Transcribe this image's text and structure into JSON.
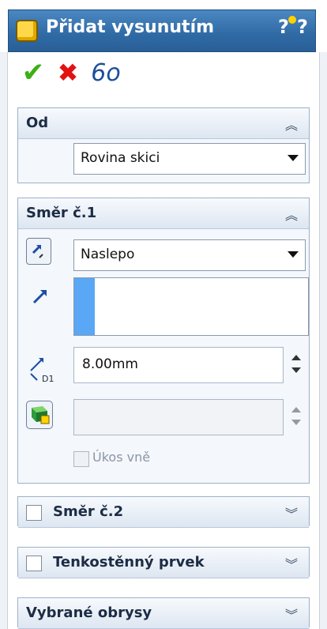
{
  "window": {
    "title": "Přidat vysunutím",
    "help_glyph": "?"
  },
  "toolbar": {
    "ok_glyph": "✔",
    "cancel_glyph": "✖",
    "preview_glyph": "6o"
  },
  "groups": {
    "od": {
      "title": "Od",
      "combo_value": "Rovina skici"
    },
    "smer1": {
      "title": "Směr č.1",
      "end_condition": "Naslepo",
      "depth_value": "8.00mm",
      "draft_label": "Úkos vně"
    },
    "smer2": {
      "title": "Směr č.2"
    },
    "thin": {
      "title": "Tenkostěnný prvek"
    },
    "contours": {
      "title": "Vybrané obrysy"
    }
  },
  "colors": {
    "title_bar": "#2f6aa5",
    "selection_blue": "#5aa7f5",
    "ok_green": "#3bb012",
    "cancel_red": "#e31212"
  },
  "icons": [
    "feature-icon",
    "help-icon",
    "reverse-direction-icon",
    "direction-arrow-icon",
    "depth-dimension-icon",
    "draft-icon",
    "collapse-icon",
    "expand-icon"
  ]
}
